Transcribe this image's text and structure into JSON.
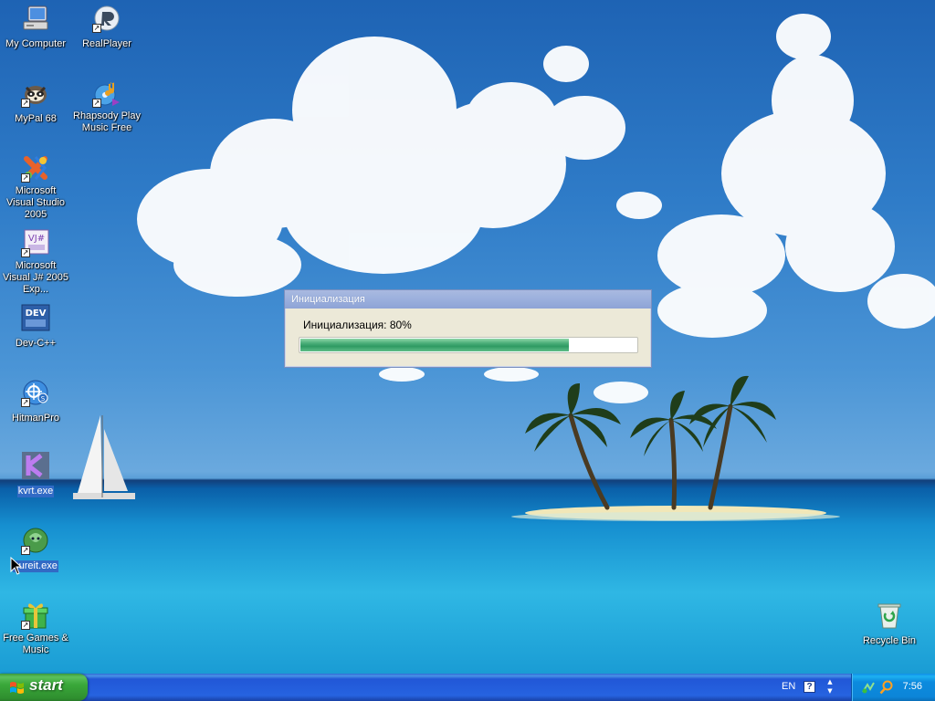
{
  "desktop": {
    "icons": [
      {
        "label": "My Computer",
        "icon": "my-computer-icon"
      },
      {
        "label": "RealPlayer",
        "icon": "realplayer-icon"
      },
      {
        "label": "MyPal 68",
        "icon": "mypal-icon"
      },
      {
        "label": "Rhapsody Play Music Free",
        "icon": "rhapsody-icon"
      },
      {
        "label": "Microsoft Visual Studio 2005",
        "icon": "visual-studio-icon"
      },
      {
        "label": "Microsoft Visual J# 2005 Exp...",
        "icon": "visual-jsharp-icon"
      },
      {
        "label": "Dev-C++",
        "icon": "dev-cpp-icon"
      },
      {
        "label": "HitmanPro",
        "icon": "hitmanpro-icon"
      },
      {
        "label": "kvrt.exe",
        "icon": "kvrt-icon"
      },
      {
        "label": "cureit.exe",
        "icon": "cureit-icon"
      },
      {
        "label": "Free Games & Music",
        "icon": "free-games-icon"
      },
      {
        "label": "Recycle Bin",
        "icon": "recycle-bin-icon"
      }
    ],
    "icon_glyphs": {
      "dev": "DEV",
      "vj": "VJ#"
    }
  },
  "dialog": {
    "title": "Инициализация",
    "status": "Инициализация: 80%",
    "progress": 0.8
  },
  "taskbar": {
    "start_label": "start",
    "language": "EN",
    "help_glyph": "?",
    "clock": "7:56"
  },
  "colors": {
    "taskbar_blue": "#2663e0",
    "start_green": "#3aa83a",
    "tray_blue": "#0c8bde",
    "dialog_bg": "#ece9d8",
    "progress_green": "#2e9a63"
  }
}
